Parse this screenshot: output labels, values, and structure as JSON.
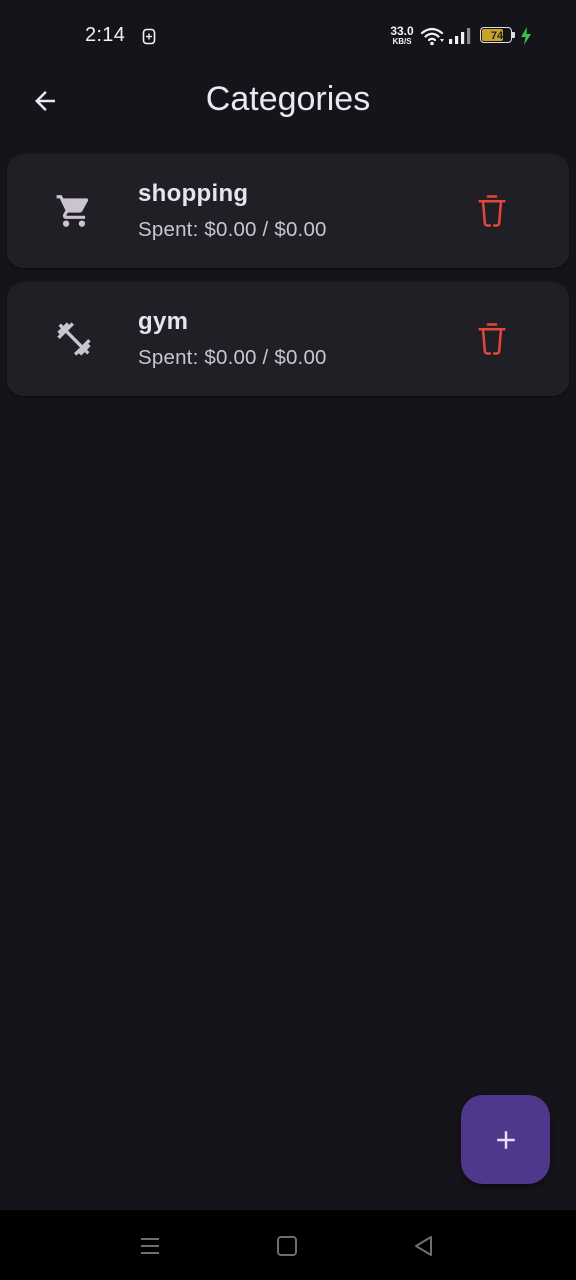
{
  "status_bar": {
    "time": "2:14",
    "net_speed_value": "33.0",
    "net_speed_unit": "KB/S",
    "battery_level": "74",
    "icons": [
      "sim-icon",
      "wifi-icon",
      "signal-icon",
      "battery-icon",
      "charging-icon"
    ]
  },
  "app_bar": {
    "title": "Categories",
    "back_icon": "arrow-back-icon"
  },
  "categories": [
    {
      "name": "shopping",
      "spent": "Spent: $0.00 / $0.00",
      "icon": "shopping-cart-icon",
      "delete_icon": "delete-icon"
    },
    {
      "name": "gym",
      "spent": "Spent: $0.00 / $0.00",
      "icon": "fitness-icon",
      "delete_icon": "delete-icon"
    }
  ],
  "fab": {
    "icon": "add-icon"
  },
  "nav_bar": {
    "icons": [
      "menu-icon",
      "home-icon",
      "back-triangle-icon"
    ]
  },
  "colors": {
    "background": "#16141b",
    "card": "#211f26",
    "accent": "#4f378b",
    "delete": "#e5453a",
    "text_primary": "#e8e3ee",
    "text_secondary": "#cac4d0"
  }
}
